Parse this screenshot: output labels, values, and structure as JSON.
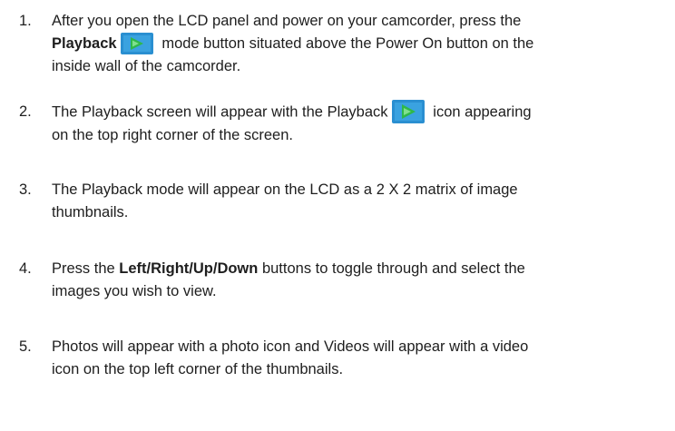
{
  "instructions": [
    {
      "number": "1.",
      "lines": [
        {
          "bold": "Playback",
          "pre": "After you open the LCD panel and power on your camcorder, press the",
          "post": "mode button situated above the Power On button on the"
        },
        "inside wall of the camcorder."
      ]
    },
    {
      "number": "2.",
      "line1_pre": "The Playback screen will appear with the Playback",
      "line1_post": "icon appearing",
      "line2": "on the top right corner of the screen."
    },
    {
      "number": "3.",
      "line1": "The Playback mode will appear on the LCD as a 2 X 2 matrix of image",
      "line2": "thumbnails."
    },
    {
      "number": "4.",
      "line1_pre": "Press the",
      "line1_bold": "Left/Right/Up/Down",
      "line1_post": "buttons to toggle through and select the",
      "line2": "images you wish to view."
    },
    {
      "number": "5.",
      "line1": "Photos will appear with a photo icon and Videos will appear with a video",
      "line2": "icon on the top left corner of the thumbnails."
    }
  ],
  "icons": {
    "playback": {
      "name": "playback-icon",
      "background": "#2a8fd1",
      "triangle": "#2fb84a"
    }
  }
}
